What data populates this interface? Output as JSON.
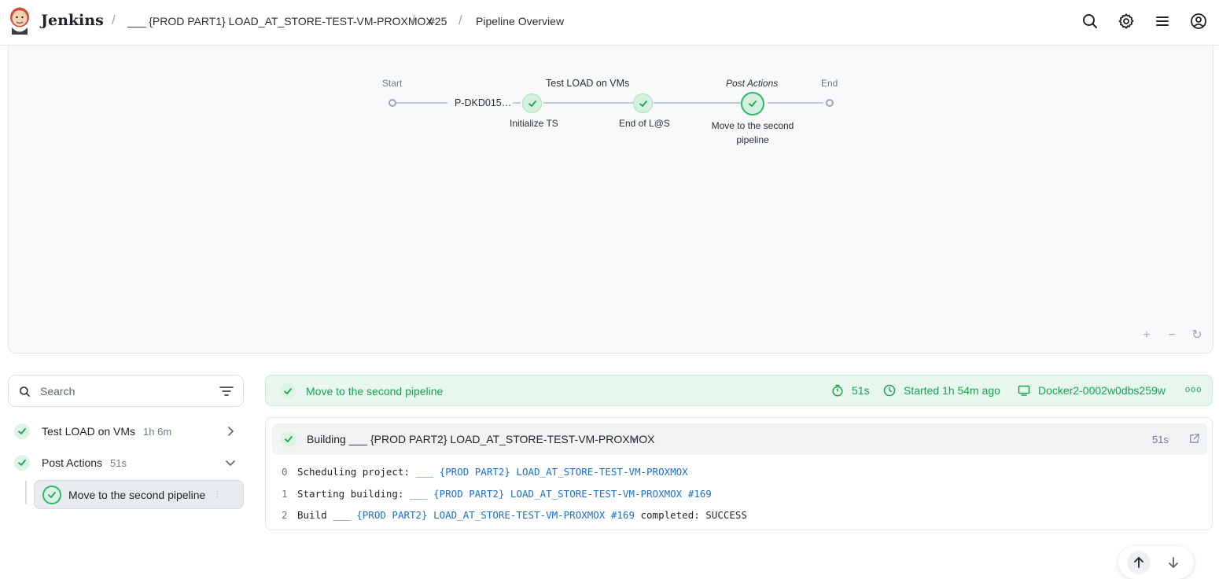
{
  "header": {
    "brand": "Jenkins",
    "breadcrumbs": [
      "___ {PROD PART1} LOAD_AT_STORE-TEST-VM-PROXMOX",
      "#25",
      "Pipeline Overview"
    ],
    "separator": "/",
    "icons": [
      "search-icon",
      "gear-icon",
      "menu-icon",
      "user-icon"
    ]
  },
  "graph": {
    "nodes": {
      "start": "Start",
      "first": "P-DKD015…",
      "parallel_title": "Test LOAD on VMs",
      "init": "Initialize TS",
      "end_ls": "End of L@S",
      "post_title": "Post Actions",
      "move": "Move to the second pipeline",
      "end": "End"
    },
    "zoom": {
      "in": "+",
      "out": "−",
      "reset": "↻"
    }
  },
  "sidebar": {
    "search_placeholder": "Search",
    "items": [
      {
        "name": "Test LOAD on VMs",
        "duration": "1h 6m",
        "status": "success",
        "expanded": false
      },
      {
        "name": "Post Actions",
        "duration": "51s",
        "status": "success",
        "expanded": true
      }
    ],
    "selected": {
      "name": "Move to the second pipeline",
      "status": "success"
    }
  },
  "stage": {
    "title": "Move to the second pipeline",
    "duration": "51s",
    "started": "Started 1h 54m ago",
    "agent": "Docker2-0002w0dbs259w",
    "more": "ooo"
  },
  "step": {
    "title": "Building ___ {PROD PART2} LOAD_AT_STORE-TEST-VM-PROXMOX",
    "duration": "51s"
  },
  "log": [
    {
      "n": "0",
      "pre": "Scheduling project: ",
      "link": "___ {PROD PART2} LOAD_AT_STORE-TEST-VM-PROXMOX",
      "post": ""
    },
    {
      "n": "1",
      "pre": "Starting building: ",
      "link": "___ {PROD PART2} LOAD_AT_STORE-TEST-VM-PROXMOX #169",
      "post": ""
    },
    {
      "n": "2",
      "pre": "Build ",
      "link": "___ {PROD PART2} LOAD_AT_STORE-TEST-VM-PROXMOX #169",
      "post": " completed: SUCCESS"
    }
  ],
  "colors": {
    "success": "#17a352",
    "success_bg": "#e8f7ee",
    "link": "#1b6fd1"
  }
}
